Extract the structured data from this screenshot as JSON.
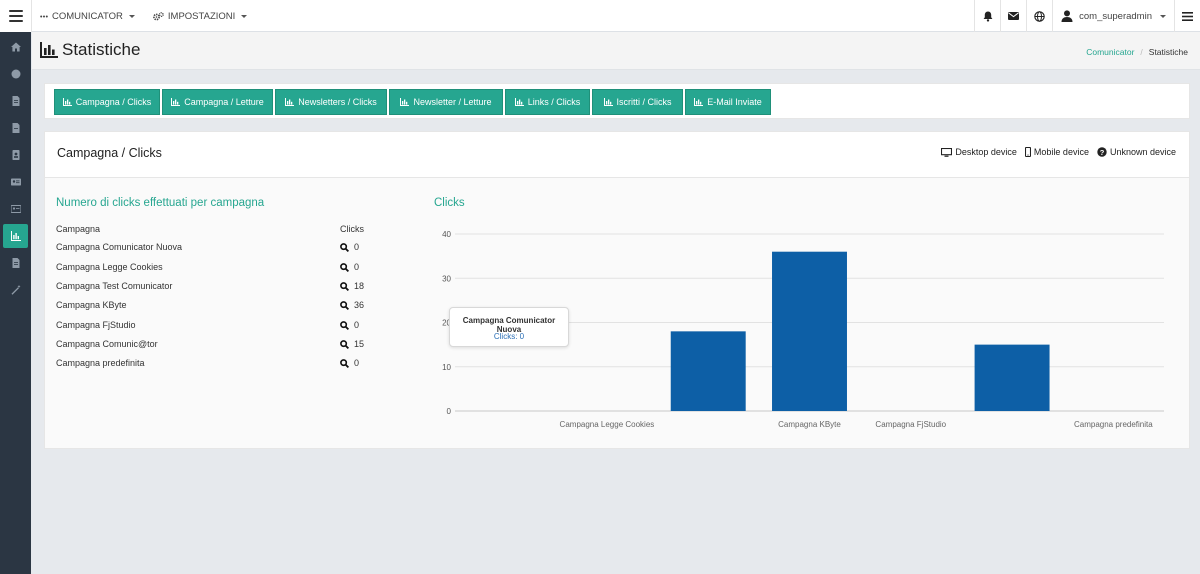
{
  "topbar": {
    "menu_comunicator": "COMUNICATOR",
    "menu_impostazioni": "IMPOSTAZIONI",
    "username": "com_superadmin"
  },
  "page": {
    "title": "Statistiche",
    "breadcrumb": [
      "Comunicator",
      "/",
      "Statistiche"
    ]
  },
  "tabs": [
    "Campagna / Clicks",
    "Campagna / Letture",
    "Newsletters / Clicks",
    "Newsletter / Letture",
    "Links / Clicks",
    "Iscritti / Clicks",
    "E-Mail Inviate"
  ],
  "panel": {
    "title": "Campagna / Clicks",
    "devices": [
      "Desktop device",
      "Mobile device",
      "Unknown device"
    ]
  },
  "table": {
    "title": "Numero di clicks effettuati per campagna",
    "col_campagna": "Campagna",
    "col_clicks": "Clicks",
    "rows": [
      {
        "name": "Campagna Comunicator Nuova",
        "clicks": "0"
      },
      {
        "name": "Campagna Legge Cookies",
        "clicks": "0"
      },
      {
        "name": "Campagna Test Comunicator",
        "clicks": "18"
      },
      {
        "name": "Campagna KByte",
        "clicks": "36"
      },
      {
        "name": "Campagna FjStudio",
        "clicks": "0"
      },
      {
        "name": "Campagna Comunic@tor",
        "clicks": "15"
      },
      {
        "name": "Campagna predefinita",
        "clicks": "0"
      }
    ]
  },
  "chart_title": "Clicks",
  "tooltip": {
    "title": "Campagna Comunicator Nuova",
    "value": "Clicks: 0"
  },
  "chart_data": {
    "type": "bar",
    "categories": [
      "Campagna Comunicator Nuova",
      "Campagna Legge Cookies",
      "Campagna Test Comunicator",
      "Campagna KByte",
      "Campagna FjStudio",
      "Campagna Comunic@tor",
      "Campagna predefinita"
    ],
    "visible_tick_labels": [
      "",
      "Campagna Legge Cookies",
      "",
      "Campagna KByte",
      "Campagna FjStudio",
      "",
      "Campagna predefinita"
    ],
    "values": [
      0,
      0,
      18,
      36,
      0,
      15,
      0
    ],
    "ylim": [
      0,
      40
    ],
    "yticks": [
      0,
      10,
      20,
      30,
      40
    ],
    "grid": true,
    "bar_color": "#0d5fa6"
  },
  "colors": {
    "accent": "#26a690",
    "sidebar": "#2b3643",
    "bar": "#0d5fa6"
  }
}
